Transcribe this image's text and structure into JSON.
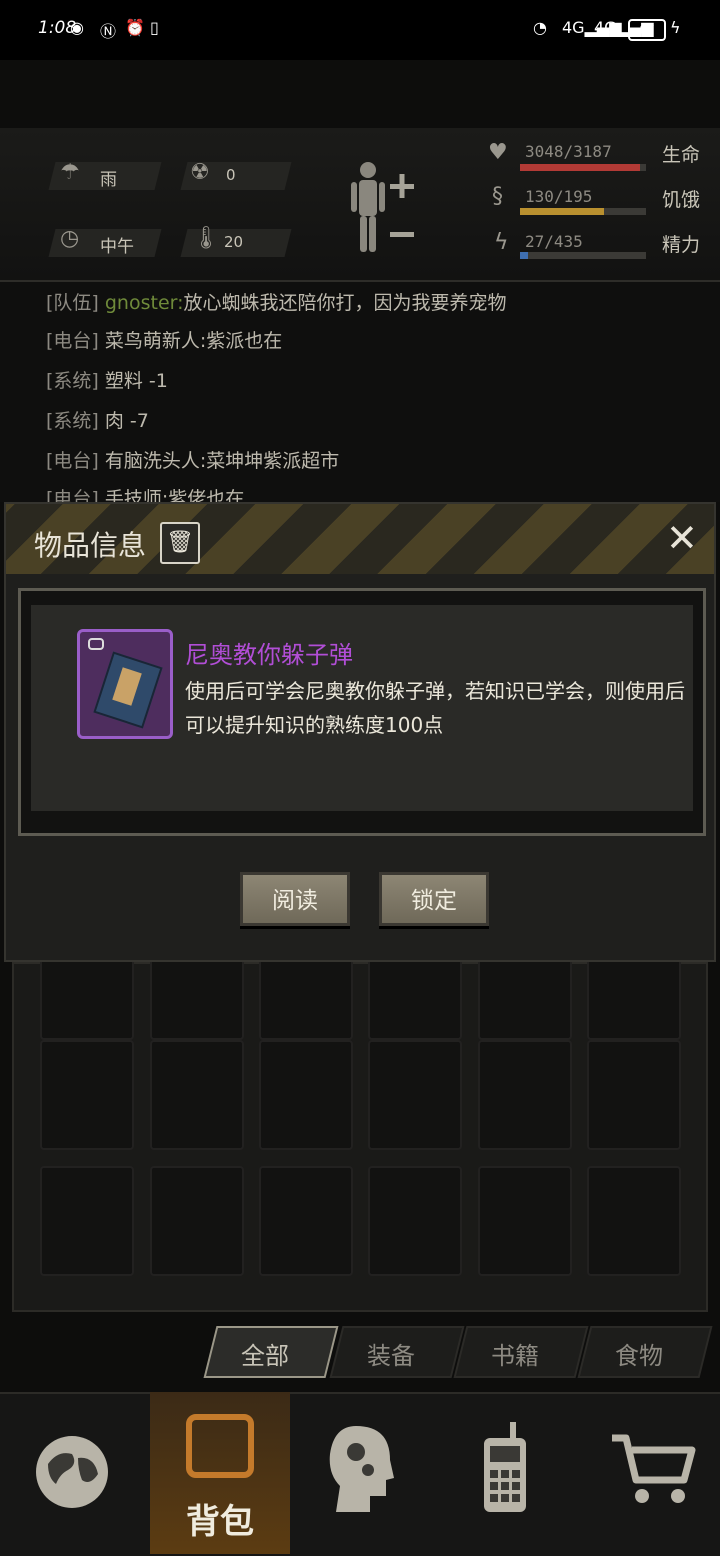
{
  "status_bar": {
    "time": "1:08",
    "battery": "87",
    "icons": [
      "eye-icon",
      "nfc-icon",
      "alarm-icon",
      "vibrate-icon",
      "wifi-icon",
      "signal-4g-icon",
      "signal-4g-icon",
      "battery-icon",
      "charging-icon"
    ]
  },
  "stats": {
    "weather": "雨",
    "radiation": "0",
    "time_of_day": "中午",
    "temperature": "20",
    "life": {
      "value": "3048/3187",
      "label": "生命",
      "fraction": 0.956,
      "color": "#b23a35"
    },
    "hunger": {
      "value": "130/195",
      "label": "饥饿",
      "fraction": 0.667,
      "color": "#b9902f"
    },
    "energy": {
      "value": "27/435",
      "label": "精力",
      "fraction": 0.062,
      "color": "#3f6fb0"
    }
  },
  "chat": [
    {
      "channel": "[队伍]",
      "sender": "gnoster:",
      "message": "放心蜘蛛我还陪你打，因为我要养宠物"
    },
    {
      "channel": "[电台]",
      "sender": "菜鸟萌新人:",
      "message": "紫派也在"
    },
    {
      "channel": "[系统]",
      "sender": "",
      "message": "塑料 -1"
    },
    {
      "channel": "[系统]",
      "sender": "",
      "message": "肉 -7"
    },
    {
      "channel": "[电台]",
      "sender": "有脑洗头人:",
      "message": "菜坤坤紫派超市"
    },
    {
      "channel": "[电台]",
      "sender": "手技师:",
      "message": "紫佬也在"
    }
  ],
  "modal": {
    "title": "物品信息",
    "item_name": "尼奥教你躲子弹",
    "description_line1": "使用后可学会尼奥教你躲子弹，若知识已学会，则使用后",
    "description_line2": "可以提升知识的熟练度100点",
    "read_button": "阅读",
    "lock_button": "锁定",
    "accent_color": "#b14ed6"
  },
  "tabs": [
    {
      "label": "全部",
      "active": true
    },
    {
      "label": "装备",
      "active": false
    },
    {
      "label": "书籍",
      "active": false
    },
    {
      "label": "食物",
      "active": false
    }
  ],
  "bottom_nav": {
    "bag_label": "背包",
    "items": [
      "globe-icon",
      "backpack-icon",
      "head-gears-icon",
      "radio-icon",
      "cart-icon"
    ]
  }
}
